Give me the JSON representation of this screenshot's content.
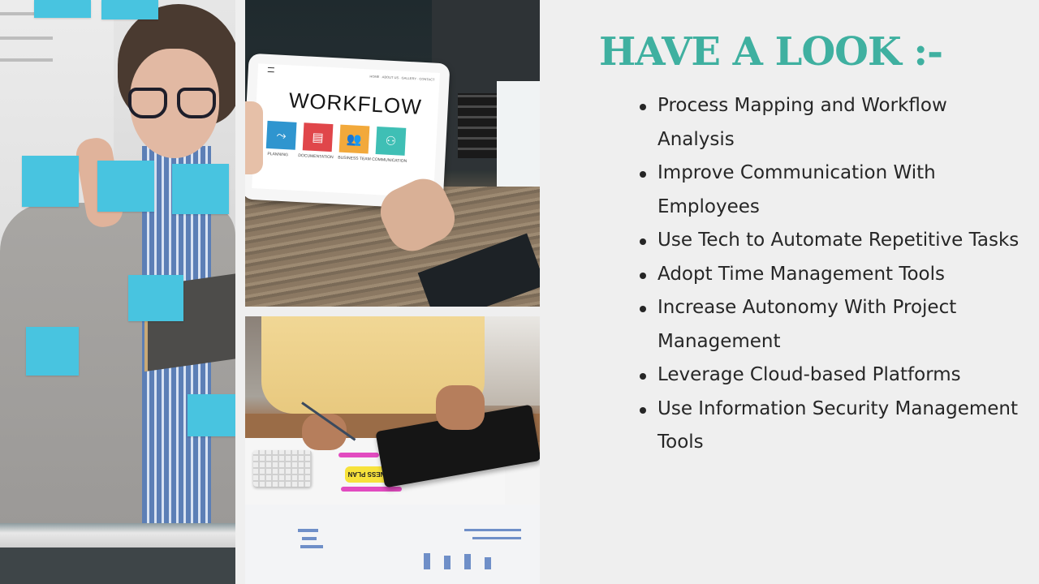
{
  "slide": {
    "title": "HAVE A LOOK :-",
    "title_color": "#3fb0a0",
    "background_color": "#efefef",
    "bullets": [
      "Process Mapping and Workflow Analysis",
      "Improve Communication With Employees",
      "Use Tech to Automate Repetitive Tasks",
      "Adopt Time Management Tools",
      "Increase Autonomy With Project Management",
      "Leverage Cloud-based Platforms",
      "Use Information Security Management Tools"
    ]
  },
  "photos": {
    "left": {
      "description": "Woman in glasses arranging blue sticky notes on glass wall"
    },
    "top": {
      "description": "Hands holding tablet showing workflow diagram",
      "screen_title": "WORKFLOW",
      "screen_nav": "HOME · ABOUT US · GALLERY · CONTACT",
      "tiles": [
        {
          "label": "PLANNING",
          "color": "#2f95cf",
          "icon": "flow-icon"
        },
        {
          "label": "DOCUMENTATION",
          "color": "#e0464a",
          "icon": "documents-icon"
        },
        {
          "label": "BUSINESS TEAM",
          "color": "#f2a93b",
          "icon": "team-icon"
        },
        {
          "label": "COMMUNICATION",
          "color": "#3fbfb5",
          "icon": "network-icon"
        }
      ]
    },
    "bottom": {
      "description": "Person writing business plan next to tablet, calculator and charts",
      "plan_label": "BUSINESS PLAN"
    }
  }
}
